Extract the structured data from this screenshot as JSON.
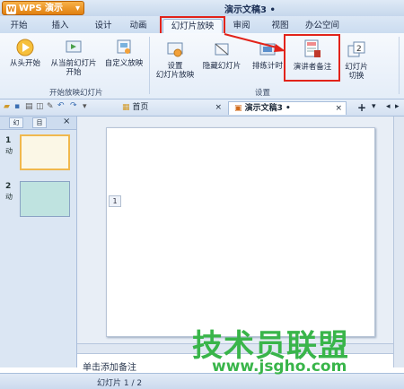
{
  "app": {
    "name": "WPS 演示",
    "logo": "W",
    "window_title": "演示文稿3 •"
  },
  "ribbon_tabs": [
    "开始",
    "插入",
    "设计",
    "动画",
    "幻灯片放映",
    "审阅",
    "视图",
    "办公空间"
  ],
  "ribbon": {
    "slideshow_group": {
      "label": "开始放映幻灯片",
      "buttons": [
        "从头开始",
        "从当前幻灯片",
        "开始",
        "自定义放映"
      ]
    },
    "setup_group": {
      "label": "设置",
      "buttons": [
        "设置",
        "幻灯片放映",
        "隐藏幻灯片",
        "排练计时",
        "演讲者备注",
        "幻灯片",
        "切换"
      ]
    }
  },
  "doc_tabs": {
    "home": "首页",
    "current": "演示文稿3 •",
    "add": "+"
  },
  "slides_panel": {
    "tab_labels": [
      "幻",
      "目"
    ],
    "slides": [
      {
        "number": "1",
        "sub": "动"
      },
      {
        "number": "2",
        "sub": "动"
      }
    ]
  },
  "canvas": {
    "slide_marker": "1"
  },
  "notes": {
    "placeholder": "单击添加备注"
  },
  "status": {
    "slide_indicator": "幻灯片 1 / 2"
  },
  "watermark": {
    "text": "技术员联盟",
    "url": "www.jsgho.com"
  },
  "colors": {
    "highlight": "#e2231a",
    "watermark": "#39b54a",
    "app_button": "#e1800f"
  }
}
